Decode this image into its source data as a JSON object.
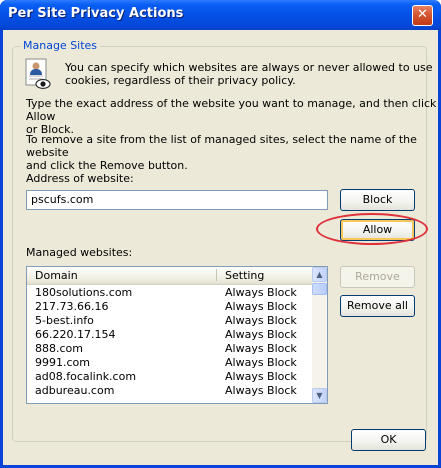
{
  "window": {
    "title": "Per Site Privacy Actions",
    "close_glyph": "✕"
  },
  "group": {
    "label": "Manage Sites"
  },
  "intro": {
    "icon": "privacy-person-eye-icon",
    "line1": "You can specify which websites are always or never allowed to use",
    "line2": "cookies, regardless of their privacy policy."
  },
  "instructions": {
    "type_line1": "Type the exact address of the website you want to manage, and then click Allow",
    "type_line2": "or Block.",
    "remove_line1": "To remove a site from the list of managed sites, select the name of the website",
    "remove_line2": "and click the Remove button."
  },
  "address": {
    "label": "Address of website:",
    "value": "pscufs.com"
  },
  "buttons": {
    "block": "Block",
    "allow": "Allow",
    "remove": "Remove",
    "remove_all": "Remove all",
    "ok": "OK"
  },
  "managed": {
    "label": "Managed websites:",
    "columns": [
      "Domain",
      "Setting"
    ],
    "rows": [
      [
        "180solutions.com",
        "Always Block"
      ],
      [
        "217.73.66.16",
        "Always Block"
      ],
      [
        "5-best.info",
        "Always Block"
      ],
      [
        "66.220.17.154",
        "Always Block"
      ],
      [
        "888.com",
        "Always Block"
      ],
      [
        "9991.com",
        "Always Block"
      ],
      [
        "ad08.focalink.com",
        "Always Block"
      ],
      [
        "adbureau.com",
        "Always Block"
      ]
    ]
  },
  "colors": {
    "accent": "#0046d5",
    "highlight_ring": "#e0303a"
  }
}
